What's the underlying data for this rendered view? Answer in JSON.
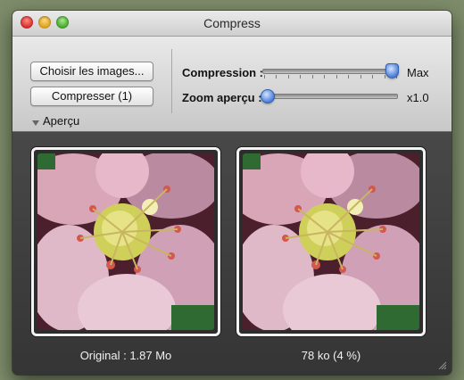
{
  "window": {
    "title": "Compress"
  },
  "toolbar": {
    "choose_images_label": "Choisir les images...",
    "compress_label": "Compresser (1)",
    "compression_label": "Compression :",
    "compression_value_label": "Max",
    "compression_level": 1.0,
    "zoom_label": "Zoom aperçu :",
    "zoom_value_label": "x1.0",
    "zoom_level": 0.0,
    "preview_toggle_label": "Aperçu"
  },
  "previews": {
    "original_caption": "Original : 1.87 Mo",
    "compressed_caption": "78 ko (4 %)"
  },
  "icons": {
    "preview_toggle": "disclosure-triangle-icon",
    "resize": "resize-grip-icon"
  },
  "colors": {
    "slider_knob": "#4c7ed8",
    "content_bg": "#3c3c3c"
  }
}
